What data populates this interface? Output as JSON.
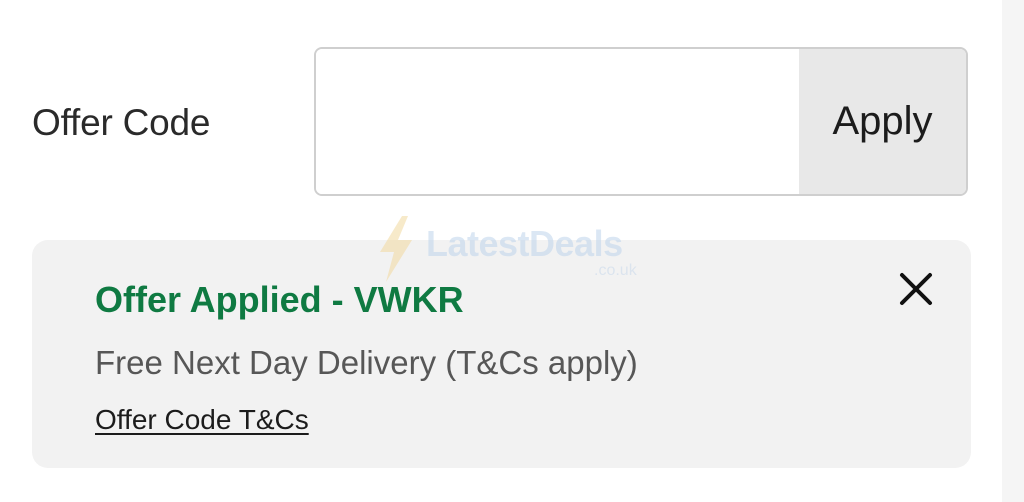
{
  "offer_code": {
    "label": "Offer Code",
    "input_value": "",
    "apply_label": "Apply"
  },
  "notice": {
    "title": "Offer Applied - VWKR",
    "description": "Free Next Day Delivery (T&Cs apply)",
    "link": "Offer Code T&Cs",
    "close_icon": "close-icon",
    "title_color": "#0f7a42"
  },
  "watermark": {
    "brand": "LatestDeals",
    "domain": ".co.uk"
  }
}
